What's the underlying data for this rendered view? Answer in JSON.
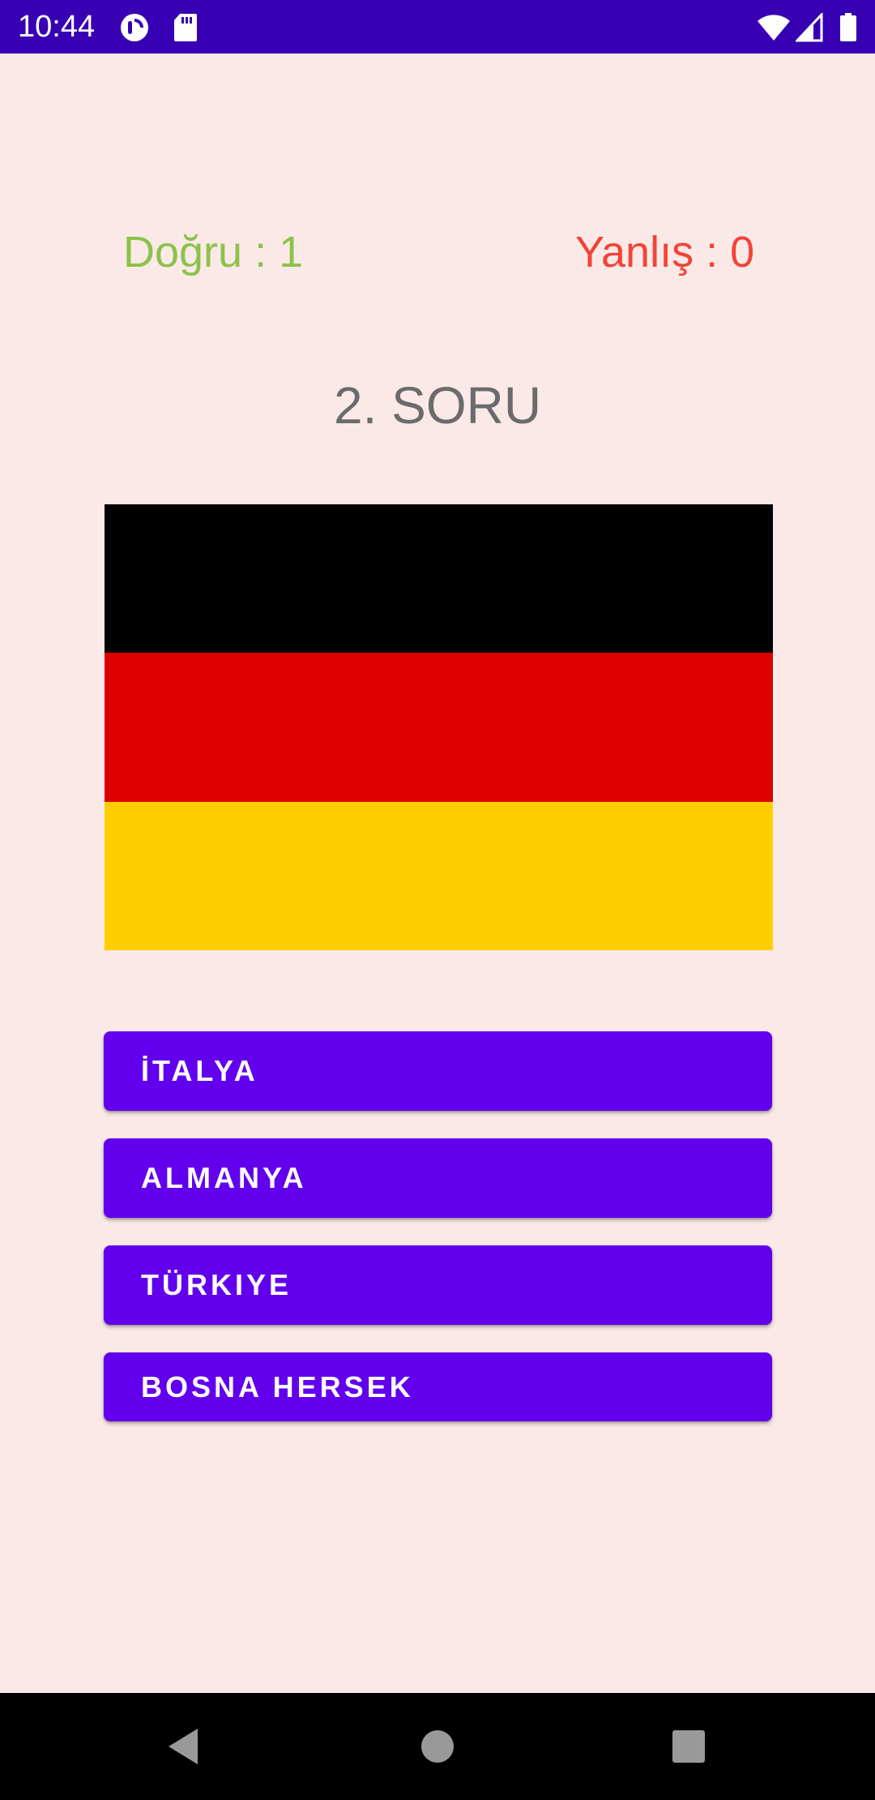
{
  "status_bar": {
    "time": "10:44",
    "background": "#3700B3",
    "icons": [
      "pocket-casts-icon",
      "sd-card-icon",
      "wifi-icon",
      "cellular-signal-icon",
      "battery-icon"
    ]
  },
  "score": {
    "correct_text": "Doğru : 1",
    "wrong_text": "Yanlış : 0",
    "correct_color": "#8BC34A",
    "wrong_color": "#F44336"
  },
  "question": {
    "title": "2. SORU"
  },
  "flag": {
    "colors": [
      "#000000",
      "#DD0000",
      "#FFCE00"
    ]
  },
  "answers": [
    {
      "label": "İTALYA"
    },
    {
      "label": "ALMANYA"
    },
    {
      "label": "TÜRKIYE"
    },
    {
      "label": "BOSNA HERSEK"
    }
  ],
  "theme": {
    "background": "#FBE9E7",
    "button_color": "#6200EE"
  },
  "nav_bar": {
    "icons": [
      "back-icon",
      "home-icon",
      "recents-icon"
    ]
  }
}
